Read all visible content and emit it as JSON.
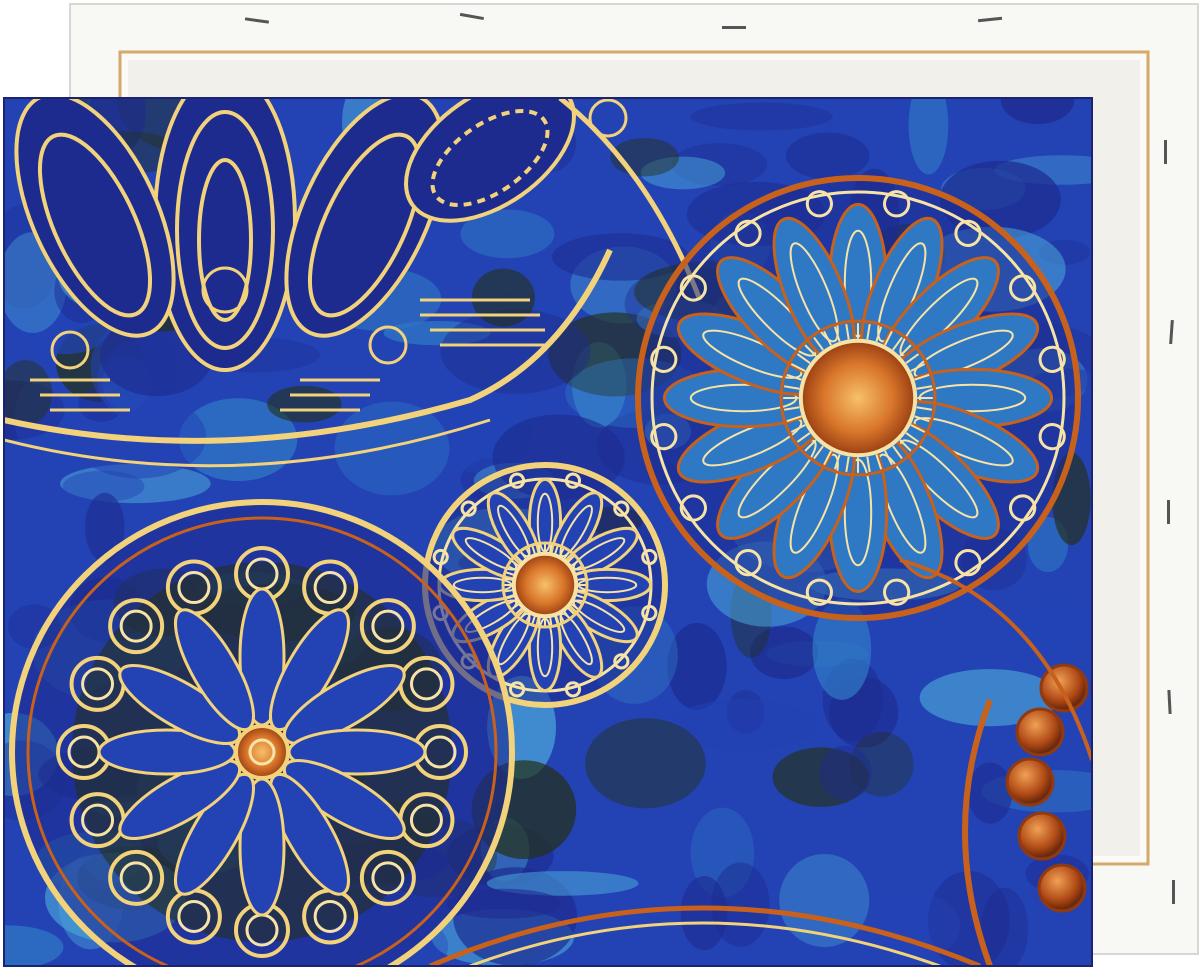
{
  "image": {
    "subject": "canvas-print-mandala",
    "palette": {
      "deep_blue": "#1d2b8f",
      "royal_blue": "#2343b5",
      "teal": "#2f78c4",
      "cyan": "#4aa4d8",
      "gold": "#f2d27a",
      "pale_gold": "#f7e3a6",
      "copper": "#c8611c",
      "rust": "#8f3a12",
      "dark_olive": "#243015",
      "canvas_white": "#f7f7f3",
      "frame_wood": "#d9b07a"
    }
  }
}
